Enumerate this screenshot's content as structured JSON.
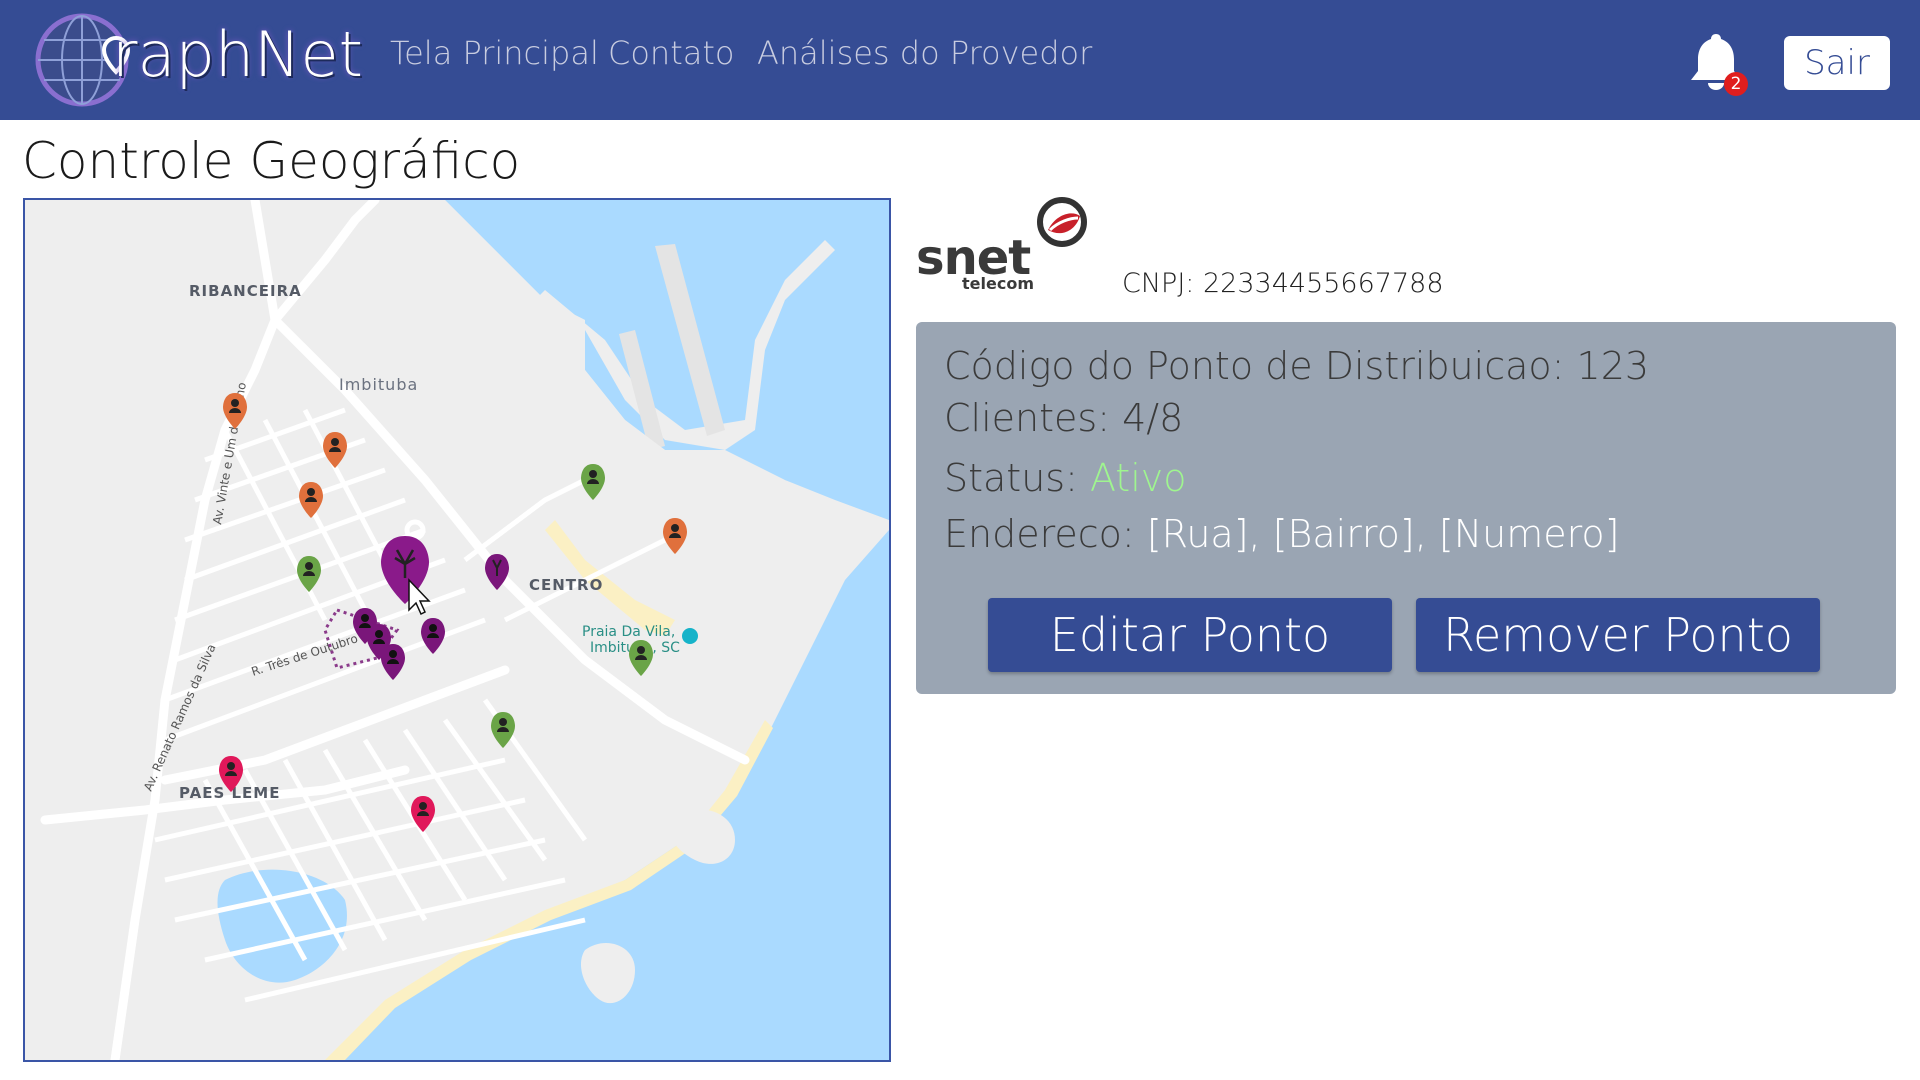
{
  "app": {
    "name": "GraphNet",
    "logo_text": "raphNet"
  },
  "nav": {
    "links": [
      {
        "label": "Tela Principal"
      },
      {
        "label": "Contato"
      },
      {
        "label": "Análises do Provedor"
      }
    ],
    "notifications_count": "2",
    "logout_label": "Sair"
  },
  "page": {
    "title": "Controle Geográfico"
  },
  "map": {
    "labels": {
      "ribanceira": "RIBANCEIRA",
      "imbituba": "Imbituba",
      "centro": "CENTRO",
      "paes_leme": "PAES LEME",
      "praia_line1": "Praia Da Vila,",
      "praia_line2": "Imbituba, SC",
      "street_vinte": "Av. Vinte e Um de Junho",
      "street_tres": "R. Três de Outubro",
      "street_renato": "Av. Renato Ramos da Silva"
    },
    "colors": {
      "water": "#aadaff",
      "land": "#eeeeee",
      "road": "#ffffff",
      "beach": "#fbf0c4",
      "pin_orange": "#e0703c",
      "pin_green": "#6aa447",
      "pin_red": "#e0185a",
      "pin_purple": "#7a167a"
    }
  },
  "provider": {
    "logo_word": "snet",
    "logo_sub": "telecom",
    "cnpj_label": "CNPJ:",
    "cnpj_value": "22334455667788"
  },
  "point": {
    "code_label": "Código do Ponto de Distribuicao:",
    "code_value": "123",
    "clients_label": "Clientes:",
    "clients_value": "4/8",
    "status_label": "Status:",
    "status_value": "Ativo",
    "address_label": "Endereco:",
    "address_value": "[Rua], [Bairro], [Numero]"
  },
  "actions": {
    "edit_label": "Editar Ponto",
    "remove_label": "Remover Ponto"
  }
}
